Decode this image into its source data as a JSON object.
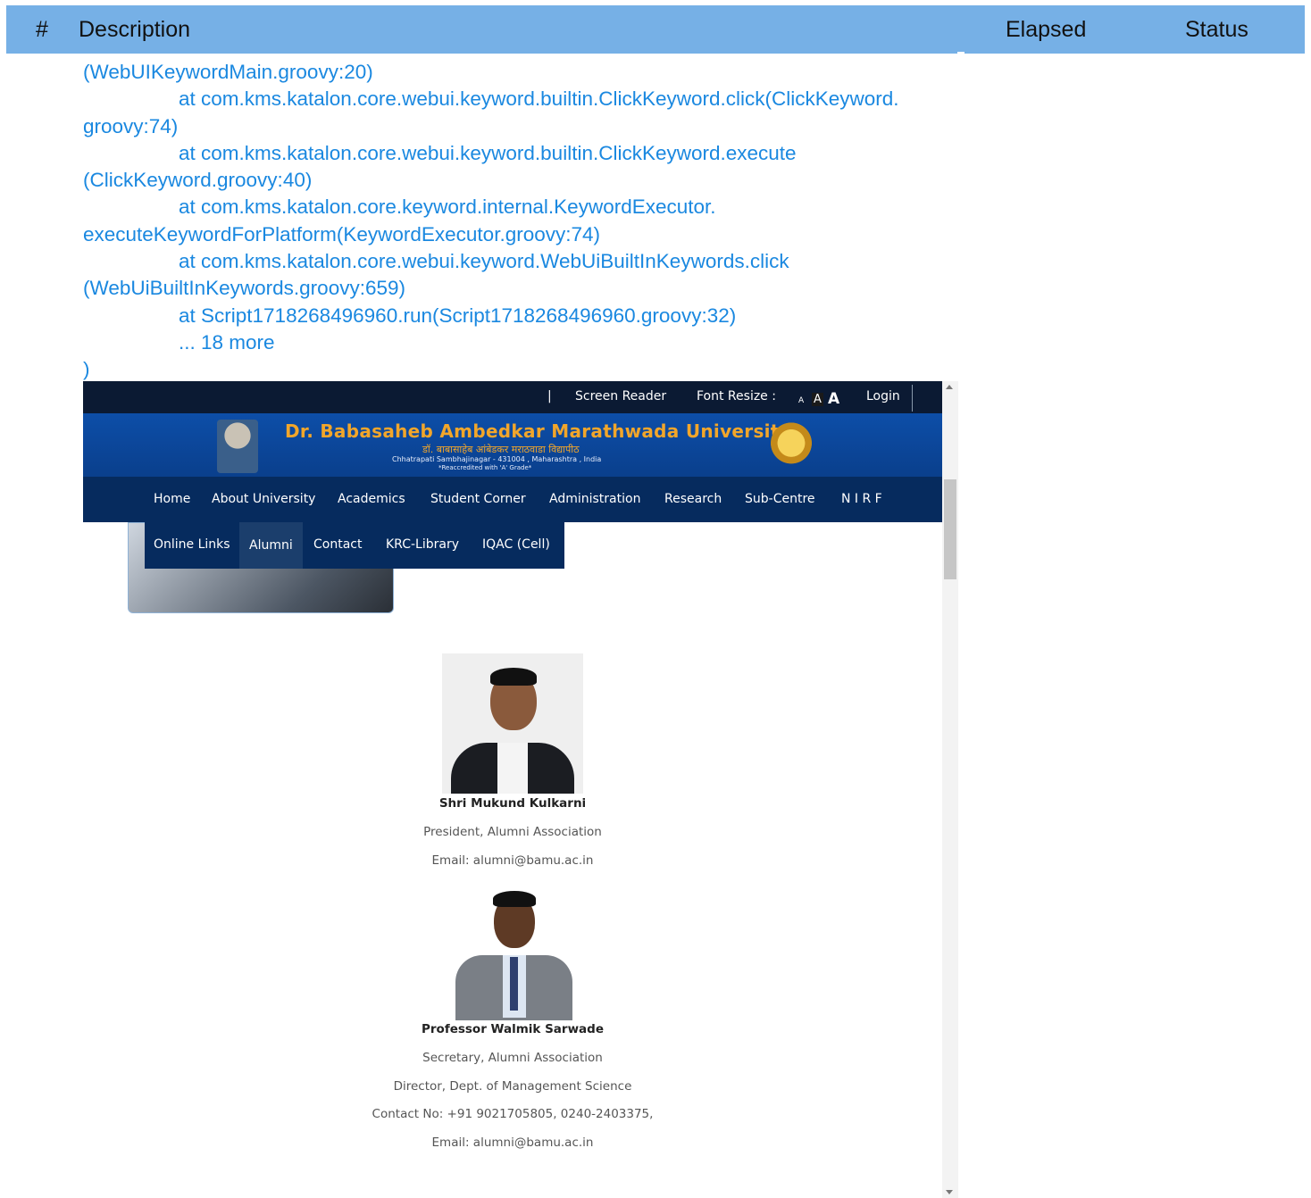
{
  "report_header": {
    "col_index": "#",
    "col_description": "Description",
    "col_elapsed": "Elapsed",
    "col_status": "Status"
  },
  "log_lines": [
    "(WebUIKeywordMain.groovy:20)",
    "at com.kms.katalon.core.webui.keyword.builtin.ClickKeyword.click(ClickKeyword.",
    "groovy:74)",
    "at com.kms.katalon.core.webui.keyword.builtin.ClickKeyword.execute",
    "(ClickKeyword.groovy:40)",
    "at com.kms.katalon.core.keyword.internal.KeywordExecutor.",
    "executeKeywordForPlatform(KeywordExecutor.groovy:74)",
    "at com.kms.katalon.core.webui.keyword.WebUiBuiltInKeywords.click",
    "(WebUiBuiltInKeywords.groovy:659)",
    "at Script1718268496960.run(Script1718268496960.groovy:32)",
    "... 18 more",
    ")"
  ],
  "screenshot": {
    "topbar": {
      "separator": "|",
      "screen_reader": "Screen Reader",
      "font_resize_label": "Font Resize :",
      "font_small": "A",
      "font_medium": "A",
      "font_large": "A",
      "login": "Login"
    },
    "banner": {
      "title": "Dr. Babasaheb Ambedkar Marathwada University",
      "subtitle_marathi": "डॉ. बाबासाहेब आंबेडकर मराठवाडा विद्यापीठ",
      "address": "Chhatrapati Sambhajinagar - 431004 , Maharashtra , India",
      "accreditation": "*Reaccredited with 'A' Grade*"
    },
    "nav": [
      "Home",
      "About University",
      "Academics",
      "Student Corner",
      "Administration",
      "Research",
      "Sub-Centre",
      "N I R F"
    ],
    "subnav": [
      "Online Links",
      "Alumni",
      "Contact",
      "KRC-Library",
      "IQAC (Cell)"
    ],
    "subnav_active": "Alumni",
    "people": [
      {
        "name": "Shri Mukund Kulkarni",
        "lines": [
          "President, Alumni Association",
          "Email: alumni@bamu.ac.in"
        ]
      },
      {
        "name": "Professor Walmik Sarwade",
        "lines": [
          "Secretary, Alumni Association",
          "Director, Dept. of Management Science",
          "Contact No: +91 9021705805, 0240-2403375,",
          "Email: alumni@bamu.ac.in"
        ]
      }
    ]
  },
  "colors": {
    "header_bg": "#76b0e6",
    "log_text": "#1a88e0",
    "site_navy": "#062b5e",
    "banner_blue": "#0d4ea8",
    "title_gold": "#f2a62a"
  }
}
